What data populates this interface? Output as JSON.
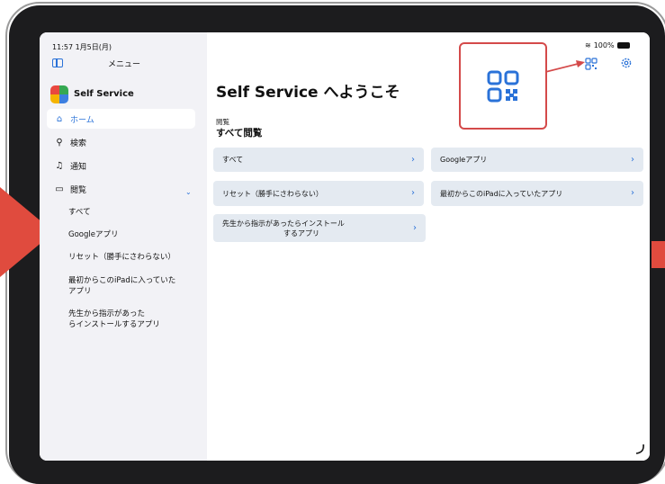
{
  "status_bar": {
    "time": "11:57 1月5日(月)",
    "battery": "100%"
  },
  "sidebar": {
    "menu_title": "メニュー",
    "app_name": "Self Service",
    "nav": [
      {
        "label": "ホーム",
        "icon": "house-icon",
        "active": true
      },
      {
        "label": "検索",
        "icon": "search-icon",
        "active": false
      },
      {
        "label": "通知",
        "icon": "bell-icon",
        "active": false
      },
      {
        "label": "閲覧",
        "icon": "folder-icon",
        "active": false
      }
    ],
    "browse_items": [
      "すべて",
      "Googleアプリ",
      "リセット（勝手にさわらない）",
      "最初からこのiPadに入っていた",
      "アプリ",
      "先生から指示があった",
      "らインストールするアプリ"
    ]
  },
  "main": {
    "title": "Self Service へようこそ",
    "section_label": "閲覧",
    "section_title": "すべて閲覧",
    "cards": [
      {
        "label": "すべて"
      },
      {
        "label": "Googleアプリ"
      },
      {
        "label": "リセット（勝手にさわらない）"
      },
      {
        "label": "最初からこのiPadに入っていたアプリ"
      },
      {
        "label_line1": "先生から指示があったらインストール",
        "label_line2": "するアプリ"
      }
    ]
  },
  "colors": {
    "accent": "#2a72d8",
    "annotation_red": "#d44a4a",
    "arrow_red": "#e04b3e",
    "card_bg": "#e4eaf1",
    "sidebar_bg": "#f2f2f6"
  },
  "icons": {
    "toolbar": [
      "qr-code-icon",
      "gear-icon"
    ],
    "callout": "qr-code-icon"
  }
}
